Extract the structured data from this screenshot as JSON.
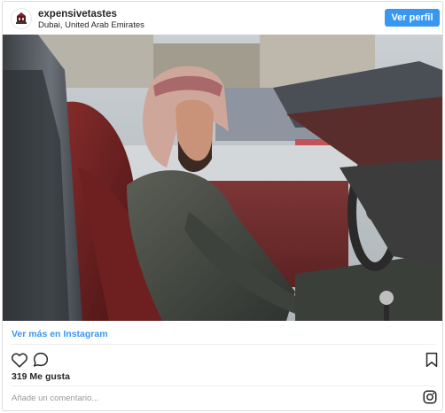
{
  "post": {
    "username": "expensivetastes",
    "location": "Dubai, United Arab Emirates",
    "profile_button": "Ver perfil",
    "more_link": "Ver más en Instagram",
    "likes": "319 Me gusta",
    "comment_placeholder": "Añade un comentario..."
  },
  "colors": {
    "accent": "#3897f0",
    "text": "#262626",
    "muted": "#999999",
    "border": "#dbdbdb"
  },
  "icons": [
    "avatar-logo",
    "heart-icon",
    "comment-icon",
    "bookmark-icon",
    "instagram-icon"
  ]
}
